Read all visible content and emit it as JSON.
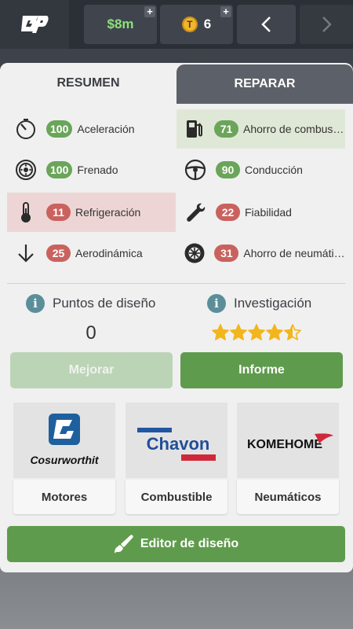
{
  "topbar": {
    "money": "$8m",
    "tokens": "6",
    "token_symbol": "T",
    "logo_icon": "gp-logo",
    "plus_glyph": "+"
  },
  "tabs": [
    {
      "label": "RESUMEN",
      "active": true
    },
    {
      "label": "REPARAR",
      "active": false
    }
  ],
  "stats": {
    "acceleration": {
      "value": "100",
      "label": "Aceleración",
      "status": "good",
      "icon": "speedometer-icon"
    },
    "fuel": {
      "value": "71",
      "label": "Ahorro de combustible",
      "status": "good",
      "icon": "fuel-pump-icon",
      "highlight": "green"
    },
    "braking": {
      "value": "100",
      "label": "Frenado",
      "status": "good",
      "icon": "brake-disc-icon"
    },
    "handling": {
      "value": "90",
      "label": "Conducción",
      "status": "good",
      "icon": "steering-wheel-icon"
    },
    "cooling": {
      "value": "11",
      "label": "Refrigeración",
      "status": "bad",
      "icon": "thermometer-icon",
      "highlight": "red"
    },
    "reliability": {
      "value": "22",
      "label": "Fiabilidad",
      "status": "bad",
      "icon": "wrench-icon"
    },
    "aero": {
      "value": "25",
      "label": "Aerodinámica",
      "status": "bad",
      "icon": "arrow-down-icon"
    },
    "tyre": {
      "value": "31",
      "label": "Ahorro de neumáticos",
      "status": "bad",
      "icon": "tyre-icon"
    }
  },
  "design_points": {
    "label": "Puntos de diseño",
    "value": "0",
    "info_glyph": "i"
  },
  "research": {
    "label": "Investigación",
    "rating": 4.5,
    "max": 5,
    "info_glyph": "i"
  },
  "buttons": {
    "improve": "Mejorar",
    "report": "Informe",
    "editor": "Editor de diseño"
  },
  "suppliers": [
    {
      "brand": "Cosurworthit",
      "label": "Motores"
    },
    {
      "brand": "Chavon",
      "label": "Combustible"
    },
    {
      "brand": "KOMEHOME",
      "label": "Neumáticos"
    }
  ],
  "colors": {
    "accent_green": "#5f9b4c",
    "badge_green": "#6aa55a",
    "badge_red": "#c9625e",
    "star": "#f2b51d"
  }
}
